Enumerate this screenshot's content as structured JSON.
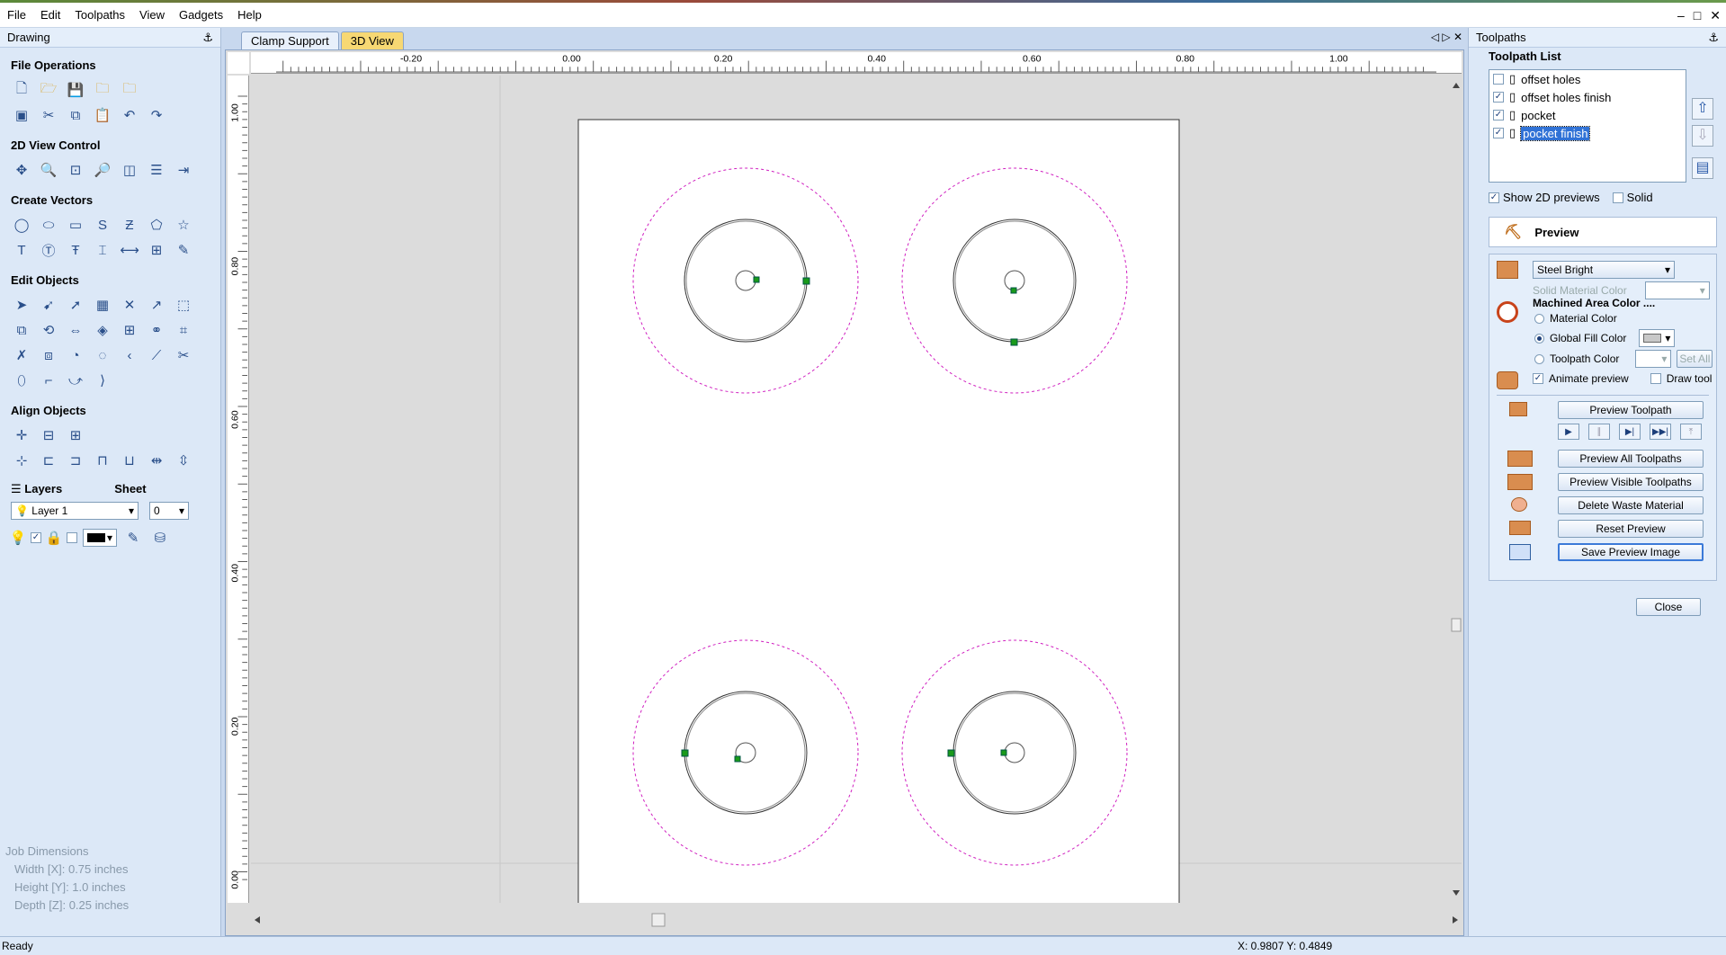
{
  "menu": [
    "File",
    "Edit",
    "Toolpaths",
    "View",
    "Gadgets",
    "Help"
  ],
  "window_controls": [
    "–",
    "□",
    "✕"
  ],
  "left_panel": {
    "title": "Drawing",
    "pin": "⚓",
    "sections": {
      "file_ops": "File Operations",
      "view_control": "2D View Control",
      "create_vectors": "Create Vectors",
      "edit_objects": "Edit Objects",
      "align_objects": "Align Objects"
    },
    "layers_label": "Layers",
    "sheet_label": "Sheet",
    "layer_value": "Layer 1",
    "sheet_value": "0",
    "job_dims": {
      "title": "Job Dimensions",
      "width": "Width  [X]: 0.75 inches",
      "height": "Height [Y]: 1.0 inches",
      "depth": "Depth  [Z]: 0.25 inches"
    }
  },
  "tabs": {
    "t1": "Clamp Support",
    "t2": "3D View",
    "ctrls": "◁ ▷ ✕"
  },
  "ruler": {
    "top": [
      "-0.20",
      "0.00",
      "0.20",
      "0.40",
      "0.60",
      "0.80",
      "1.00"
    ],
    "left": [
      "1.00",
      "0.80",
      "0.60",
      "0.40",
      "0.20",
      "0.00"
    ]
  },
  "status": {
    "left": "Ready",
    "coords": "X: 0.9807 Y: 0.4849"
  },
  "right_panel": {
    "title": "Toolpaths",
    "list_title": "Toolpath List",
    "items": [
      {
        "label": "offset holes",
        "checked": ""
      },
      {
        "label": "offset holes finish",
        "checked": "✓"
      },
      {
        "label": "pocket",
        "checked": "✓"
      },
      {
        "label": "pocket finish",
        "checked": "✓"
      }
    ],
    "show2d": "Show 2D previews",
    "show2d_checked": "✓",
    "solid": "Solid",
    "preview": "Preview",
    "material": "Steel Bright",
    "solid_material_color": "Solid Material Color",
    "machined_area": "Machined Area Color ....",
    "material_color": "Material Color",
    "global_fill": "Global Fill Color",
    "toolpath_color": "Toolpath Color",
    "set_all": "Set All",
    "animate": "Animate preview",
    "animate_checked": "✓",
    "draw_tool": "Draw tool",
    "buttons": {
      "preview_toolpath": "Preview Toolpath",
      "preview_all": "Preview All Toolpaths",
      "preview_visible": "Preview Visible Toolpaths",
      "delete_waste": "Delete Waste Material",
      "reset": "Reset Preview",
      "save_image": "Save Preview Image",
      "close": "Close"
    },
    "playback": [
      "▶",
      "∥",
      "▶|",
      "▶▶|",
      "⤒"
    ]
  }
}
